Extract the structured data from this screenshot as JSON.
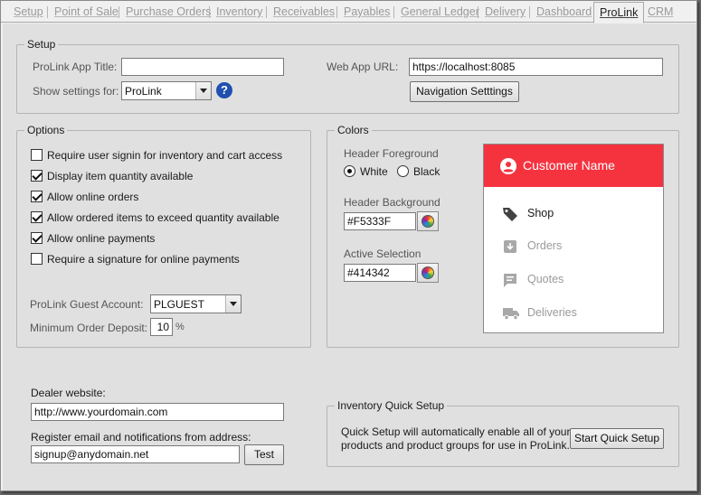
{
  "tabs": [
    {
      "label": "Setup"
    },
    {
      "label": "Point of Sale"
    },
    {
      "label": "Purchase Orders"
    },
    {
      "label": "Inventory"
    },
    {
      "label": "Receivables"
    },
    {
      "label": "Payables"
    },
    {
      "label": "General Ledger"
    },
    {
      "label": "Delivery"
    },
    {
      "label": "Dashboard"
    },
    {
      "label": "ProLink",
      "active": true
    },
    {
      "label": "CRM"
    }
  ],
  "setup": {
    "title": "Setup",
    "app_title_label": "ProLink App Title:",
    "app_title_value": "",
    "show_settings_label": "Show settings for:",
    "show_settings_value": "ProLink",
    "help_glyph": "?",
    "web_app_url_label": "Web App URL:",
    "web_app_url_value": "https://localhost:8085",
    "nav_settings_button": "Navigation Setttings"
  },
  "options": {
    "title": "Options",
    "checkboxes": [
      {
        "label": "Require user signin for inventory and cart access",
        "checked": false
      },
      {
        "label": "Display item quantity available",
        "checked": true
      },
      {
        "label": "Allow online orders",
        "checked": true
      },
      {
        "label": "Allow ordered items to exceed quantity available",
        "checked": true
      },
      {
        "label": "Allow online payments",
        "checked": true
      },
      {
        "label": "Require a signature for online payments",
        "checked": false
      }
    ],
    "guest_account_label": "ProLink Guest Account:",
    "guest_account_value": "PLGUEST",
    "min_deposit_label": "Minimum Order Deposit:",
    "min_deposit_value": "10",
    "min_deposit_unit": "%"
  },
  "colors": {
    "title": "Colors",
    "header_fg_label": "Header Foreground",
    "fg_white_label": "White",
    "fg_black_label": "Black",
    "fg_selected": "White",
    "header_bg_label": "Header Background",
    "header_bg_value": "#F5333F",
    "active_sel_label": "Active Selection",
    "active_sel_value": "#414342",
    "preview": {
      "header_text": "Customer Name",
      "header_color": "#F5333F",
      "active_color": "#414342",
      "inactive_color": "#a8a8a8",
      "items": [
        {
          "label": "Shop",
          "icon": "tag-icon",
          "active": true
        },
        {
          "label": "Orders",
          "icon": "download-box-icon",
          "active": false
        },
        {
          "label": "Quotes",
          "icon": "message-icon",
          "active": false
        },
        {
          "label": "Deliveries",
          "icon": "truck-icon",
          "active": false
        }
      ]
    }
  },
  "dealer": {
    "website_label": "Dealer website:",
    "website_value": "http://www.yourdomain.com",
    "email_label": "Register email and notifications from address:",
    "email_value": "signup@anydomain.net",
    "test_button": "Test"
  },
  "quick_setup": {
    "title": "Inventory Quick Setup",
    "description_line1": "Quick Setup will automatically enable all of your",
    "description_line2": "products and product groups for use in ProLink.",
    "button": "Start Quick Setup"
  }
}
